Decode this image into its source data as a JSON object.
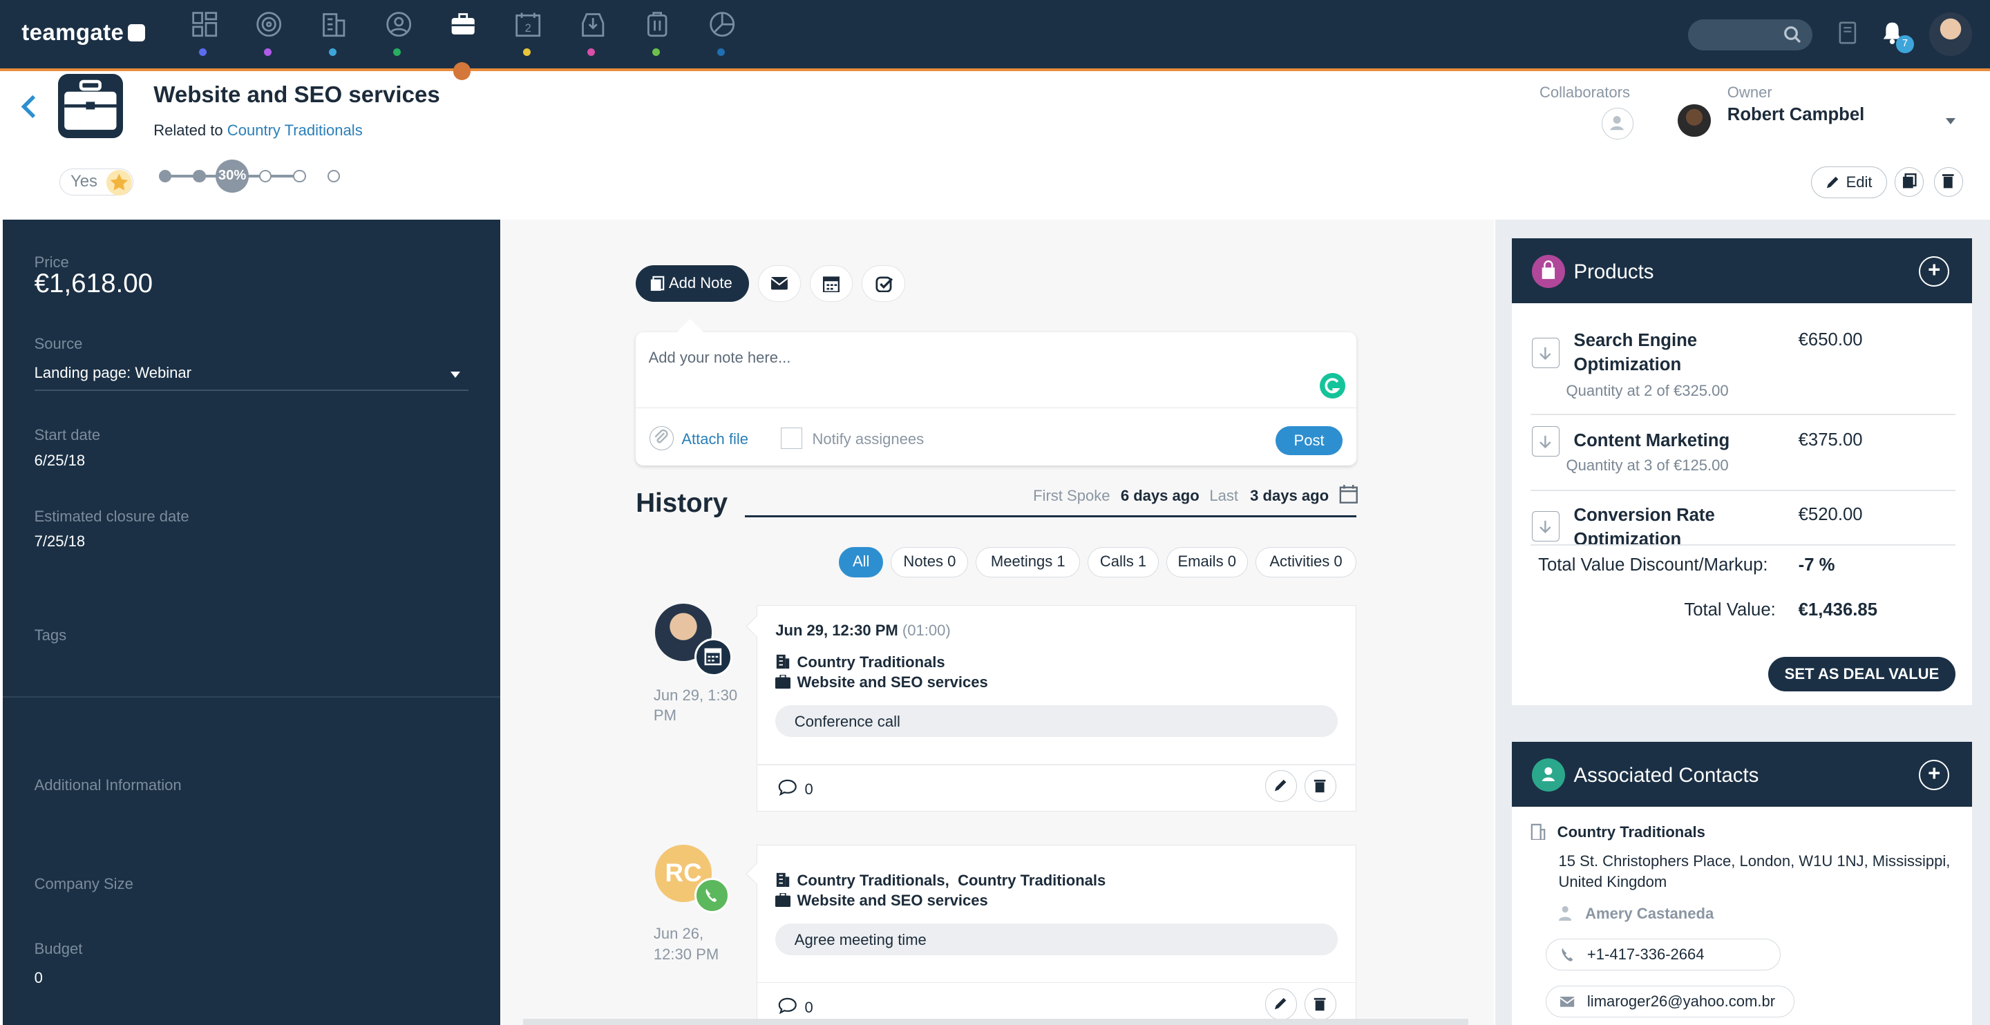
{
  "app": {
    "logo": "teamgate",
    "notification_count": "7"
  },
  "nav": {
    "icons": [
      {
        "name": "dashboard-icon",
        "color": "#5b6cf0"
      },
      {
        "name": "target-icon",
        "color": "#b05ce8"
      },
      {
        "name": "building-icon",
        "color": "#3da5d9"
      },
      {
        "name": "person-icon",
        "color": "#27ae60"
      },
      {
        "name": "briefcase-icon",
        "color": "#e88c3a"
      },
      {
        "name": "calendar-icon",
        "color": "#e8c53a"
      },
      {
        "name": "inbox-icon",
        "color": "#d94fa8"
      },
      {
        "name": "clipboard-icon",
        "color": "#6cc04a"
      },
      {
        "name": "chart-icon",
        "color": "#1f6fb2"
      }
    ]
  },
  "deal": {
    "title": "Website and SEO services",
    "related_prefix": "Related to",
    "related_link": "Country Traditionals",
    "hot_label": "Yes",
    "progress_label": "30%",
    "progress": 0.3
  },
  "people": {
    "collaborators_label": "Collaborators",
    "owner_label": "Owner",
    "owner_name": "Robert Campbel"
  },
  "actions": {
    "edit_label": "Edit"
  },
  "fields": {
    "price_label": "Price",
    "price_value": "€1,618.00",
    "source_label": "Source",
    "source_value": "Landing page: Webinar",
    "start_label": "Start date",
    "start_value": "6/25/18",
    "close_label": "Estimated closure date",
    "close_value": "7/25/18",
    "tags_label": "Tags",
    "additional_label": "Additional Information",
    "company_size_label": "Company Size",
    "budget_label": "Budget",
    "budget_value": "0"
  },
  "composer": {
    "add_note_label": "Add Note",
    "placeholder": "Add your note here...",
    "attach_label": "Attach file",
    "notify_label": "Notify assignees",
    "post_label": "Post"
  },
  "history": {
    "title": "History",
    "first_spoke_label": "First Spoke",
    "first_spoke_value": "6 days ago",
    "last_label": "Last",
    "last_value": "3 days ago",
    "filters": [
      "All",
      "Notes 0",
      "Meetings 1",
      "Calls 1",
      "Emails 0",
      "Activities 0"
    ],
    "entries": [
      {
        "time": "Jun 29, 12:30 PM",
        "duration": "(01:00)",
        "company": "Country Traditionals",
        "deal": "Website and SEO services",
        "subject": "Conference call",
        "comments": "0",
        "date_line1": "Jun 29, 1:30",
        "date_line2": "PM"
      },
      {
        "initials": "RC",
        "company": "Country Traditionals,",
        "company2": "Country Traditionals",
        "deal": "Website and SEO services",
        "subject": "Agree meeting time",
        "comments": "0",
        "date_line1": "Jun 26,",
        "date_line2": "12:30 PM"
      }
    ]
  },
  "products": {
    "title": "Products",
    "items": [
      {
        "name_line1": "Search Engine",
        "name_line2": "Optimization",
        "price": "€650.00",
        "sub": "Quantity at 2 of €325.00"
      },
      {
        "name_line1": "Content Marketing",
        "price": "€375.00",
        "sub": "Quantity at 3 of €125.00"
      },
      {
        "name_line1": "Conversion Rate",
        "name_line2": "Optimization",
        "price": "€520.00"
      }
    ],
    "discount_label": "Total Value Discount/Markup:",
    "discount_value": "-7 %",
    "total_label": "Total Value:",
    "total_value": "€1,436.85",
    "set_deal_label": "SET AS DEAL VALUE"
  },
  "contacts": {
    "title": "Associated Contacts",
    "company": "Country Traditionals",
    "address_line1": "15 St. Christophers Place, London, W1U 1NJ, Mississippi,",
    "address_line2": "United Kingdom",
    "person": "Amery Castaneda",
    "phone": "+1-417-336-2664",
    "email": "limaroger26@yahoo.com.br"
  }
}
